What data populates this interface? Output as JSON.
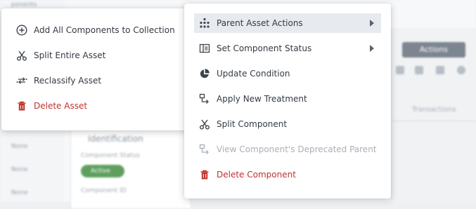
{
  "background": {
    "sidebar_texts": [
      "ponents",
      "None",
      "None",
      "None"
    ],
    "card_title": "Identification",
    "card_status_label": "Component Status",
    "status_pill": "Active",
    "card_id_label": "Component ID",
    "actions_button": "Actions",
    "transactions_tab": "Transactions"
  },
  "left_menu": {
    "items": [
      {
        "label": "Add All Components to Collection",
        "icon": "plus-circle-icon"
      },
      {
        "label": "Split Entire Asset",
        "icon": "scissors-icon"
      },
      {
        "label": "Reclassify Asset",
        "icon": "reclassify-arrows-icon"
      },
      {
        "label": "Delete Asset",
        "icon": "trash-icon",
        "danger": true
      }
    ]
  },
  "right_menu": {
    "items": [
      {
        "label": "Parent Asset Actions",
        "icon": "hierarchy-icon",
        "submenu": true,
        "highlighted": true
      },
      {
        "label": "Set Component Status",
        "icon": "status-panel-icon",
        "submenu": true
      },
      {
        "label": "Update Condition",
        "icon": "pie-chart-icon"
      },
      {
        "label": "Apply New Treatment",
        "icon": "treatment-arrow-icon"
      },
      {
        "label": "Split Component",
        "icon": "scissors-icon"
      },
      {
        "label": "View Component's Deprecated Parent",
        "icon": "treatment-arrow-icon",
        "disabled": true
      },
      {
        "label": "Delete Component",
        "icon": "trash-icon",
        "danger": true
      }
    ]
  },
  "colors": {
    "danger": "#c0322d",
    "text": "#333a42",
    "disabled": "#a9b0b8",
    "highlight": "#e7eaee"
  }
}
